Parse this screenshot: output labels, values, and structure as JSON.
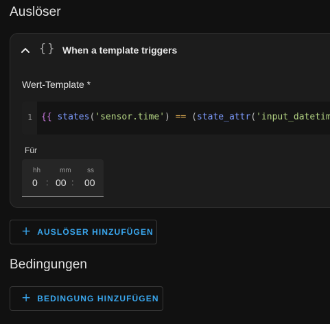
{
  "triggers_section": {
    "title": "Auslöser",
    "trigger_card": {
      "icon": "template-braces-icon",
      "icon_glyph": "{}",
      "name": "When a template triggers",
      "value_template_label": "Wert-Template *",
      "editor": {
        "line_number": "1",
        "tokens": [
          {
            "text": "{{",
            "kind": "brace"
          },
          {
            "text": " ",
            "kind": "plain"
          },
          {
            "text": "states",
            "kind": "ident"
          },
          {
            "text": "(",
            "kind": "plain"
          },
          {
            "text": "'sensor.time'",
            "kind": "str"
          },
          {
            "text": ") ",
            "kind": "plain"
          },
          {
            "text": "==",
            "kind": "op"
          },
          {
            "text": " (",
            "kind": "plain"
          },
          {
            "text": "state_attr",
            "kind": "ident"
          },
          {
            "text": "(",
            "kind": "plain"
          },
          {
            "text": "'input_datetime",
            "kind": "str"
          }
        ]
      },
      "for_label": "Für",
      "duration": {
        "hh_label": "hh",
        "mm_label": "mm",
        "ss_label": "ss",
        "hh": "0",
        "mm": "00",
        "ss": "00",
        "separator": ":"
      }
    },
    "add_button_label": "AUSLÖSER HINZUFÜGEN"
  },
  "conditions_section": {
    "title": "Bedingungen",
    "add_button_label": "BEDINGUNG HINZUFÜGEN"
  },
  "colors": {
    "background": "#111111",
    "card": "#1c1c1c",
    "accent": "#3aa8f0"
  }
}
